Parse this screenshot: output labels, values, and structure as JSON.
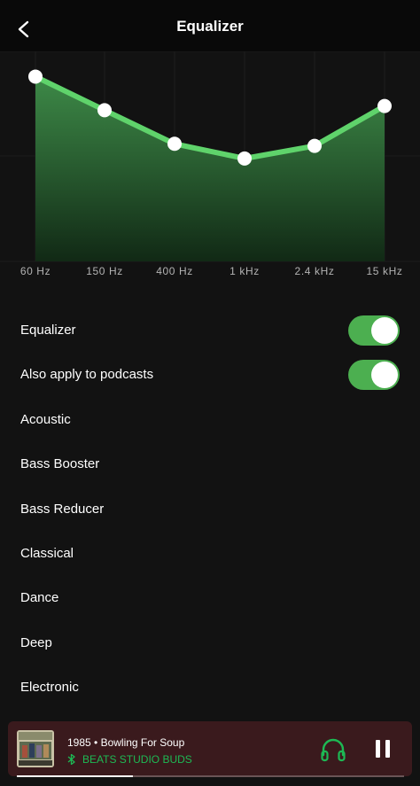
{
  "header": {
    "title": "Equalizer"
  },
  "equalizer": {
    "bands": [
      {
        "freq": "60 Hz",
        "level": 0.88
      },
      {
        "freq": "150 Hz",
        "level": 0.72
      },
      {
        "freq": "400 Hz",
        "level": 0.56
      },
      {
        "freq": "1 kHz",
        "level": 0.49
      },
      {
        "freq": "2.4 kHz",
        "level": 0.55
      },
      {
        "freq": "15 kHz",
        "level": 0.74
      }
    ],
    "accent_color": "#5fd36b"
  },
  "settings": {
    "equalizer_label": "Equalizer",
    "equalizer_enabled": true,
    "podcasts_label": "Also apply to podcasts",
    "podcasts_enabled": true
  },
  "presets": [
    "Acoustic",
    "Bass Booster",
    "Bass Reducer",
    "Classical",
    "Dance",
    "Deep",
    "Electronic"
  ],
  "player": {
    "track": "1985 • Bowling For Soup",
    "device": "BEATS STUDIO BUDS",
    "progress": 0.3,
    "background_color": "#3a1a1d",
    "device_color": "#1db954"
  }
}
